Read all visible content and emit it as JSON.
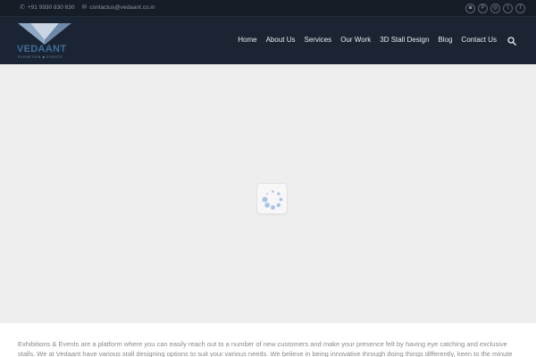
{
  "topbar": {
    "phone": "+91 9930 830 630",
    "email": "contactus@vedaant.co.in",
    "phone_icon": "phone-icon",
    "email_icon": "mail-icon",
    "social": [
      {
        "name": "instagram-icon",
        "glyph": "◙"
      },
      {
        "name": "pinterest-icon",
        "glyph": "P"
      },
      {
        "name": "instagram-alt-icon",
        "glyph": "◎"
      },
      {
        "name": "twitter-icon",
        "glyph": "t"
      },
      {
        "name": "facebook-icon",
        "glyph": "f"
      }
    ]
  },
  "header": {
    "logo_text": "VEDAANT",
    "logo_tagline": "EXHIBITION ◆ EVENTS",
    "nav": [
      "Home",
      "About Us",
      "Services",
      "Our Work",
      "3D Stall Design",
      "Blog",
      "Contact Us"
    ],
    "search_icon": "search-icon"
  },
  "colors": {
    "topbar_bg": "#161d27",
    "header_bg": "#1b2432",
    "stage_bg": "#eeeeee",
    "loader_dot": "#a9c3e6"
  },
  "loader": {
    "icon": "spinner-icon"
  },
  "about": {
    "text": "Exhibitions & Events are a platform where you can easily reach out to a number of new customers and make your presence felt by having eye catching and exclusive stalls. We at Vedaant have various stall designing options to suit your various needs. We believe in being innovative through doing things differently, keen to the minute detail, dedicated"
  }
}
